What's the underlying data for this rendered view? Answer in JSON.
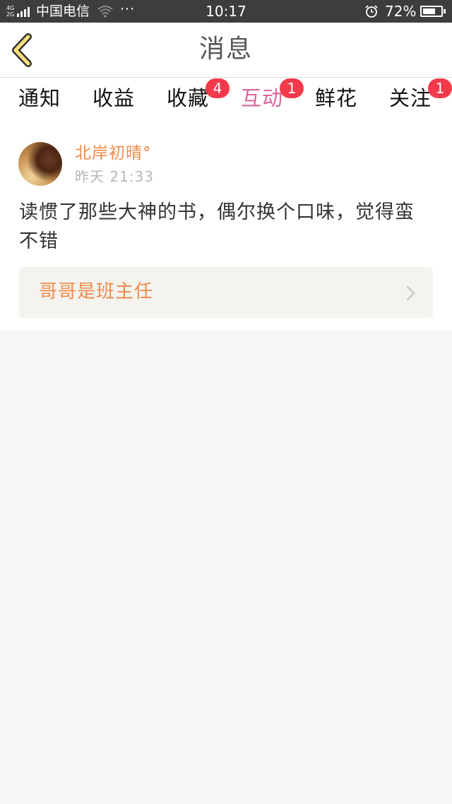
{
  "status_bar": {
    "network_top": "4G",
    "network_bottom": "2G",
    "carrier": "中国电信",
    "more": "···",
    "time": "10:17",
    "battery_percent": "72%",
    "battery_level": 0.72
  },
  "header": {
    "title": "消息",
    "back_icon": "chevron-left-icon"
  },
  "tabs": [
    {
      "label": "通知",
      "badge": ""
    },
    {
      "label": "收益",
      "badge": ""
    },
    {
      "label": "收藏",
      "badge": "4"
    },
    {
      "label": "互动",
      "badge": "1",
      "active": true
    },
    {
      "label": "鲜花",
      "badge": ""
    },
    {
      "label": "关注",
      "badge": "1"
    }
  ],
  "message": {
    "username": "北岸初晴°",
    "timestamp": "昨天 21:33",
    "comment": "读惯了那些大神的书，偶尔换个口味，觉得蛮不错",
    "book_title": "哥哥是班主任"
  },
  "colors": {
    "accent": "#e0649a",
    "name_orange": "#f08a4b",
    "badge_red": "#f23a4b",
    "back_icon_yellow": "#f6e27a"
  }
}
